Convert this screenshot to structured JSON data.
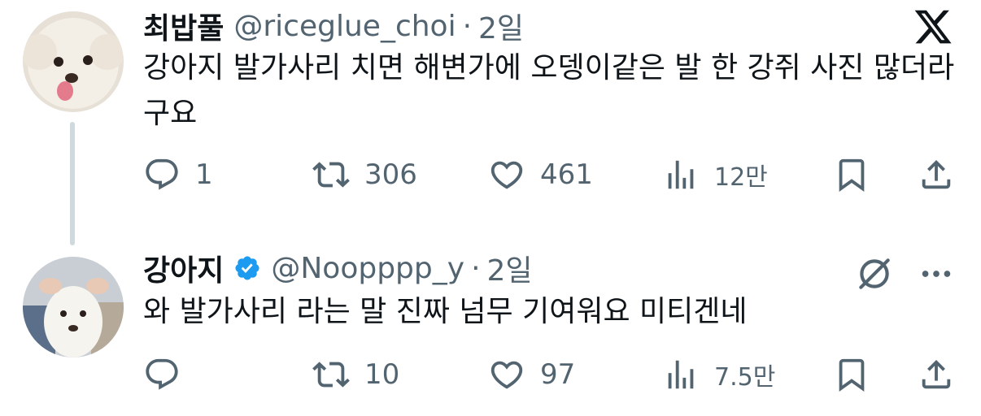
{
  "tweet1": {
    "name": "최밥풀",
    "handle": "@riceglue_choi",
    "separator": "·",
    "time": "2일",
    "text": "강아지 발가사리 치면 해변가에 오뎅이같은 발 한 강쥐 사진 많더라구요",
    "stats": {
      "replies": "1",
      "reposts": "306",
      "likes": "461",
      "views": "12만"
    }
  },
  "tweet2": {
    "name": "강아지",
    "handle": "@Noopppp_y",
    "separator": "·",
    "time": "2일",
    "verified": true,
    "text": "와 발가사리 라는 말 진짜 넘무 기여워요 미티겐네",
    "stats": {
      "replies": "",
      "reposts": "10",
      "likes": "97",
      "views": "7.5만"
    }
  },
  "colors": {
    "text": "#0f1419",
    "muted": "#536471",
    "verified": "#1d9bf0",
    "thread_line": "#cfd9de"
  },
  "icons": [
    "x-logo-icon",
    "reply-icon",
    "repost-icon",
    "like-icon",
    "views-icon",
    "bookmark-icon",
    "share-icon",
    "verified-badge-icon",
    "grok-icon",
    "more-icon"
  ]
}
